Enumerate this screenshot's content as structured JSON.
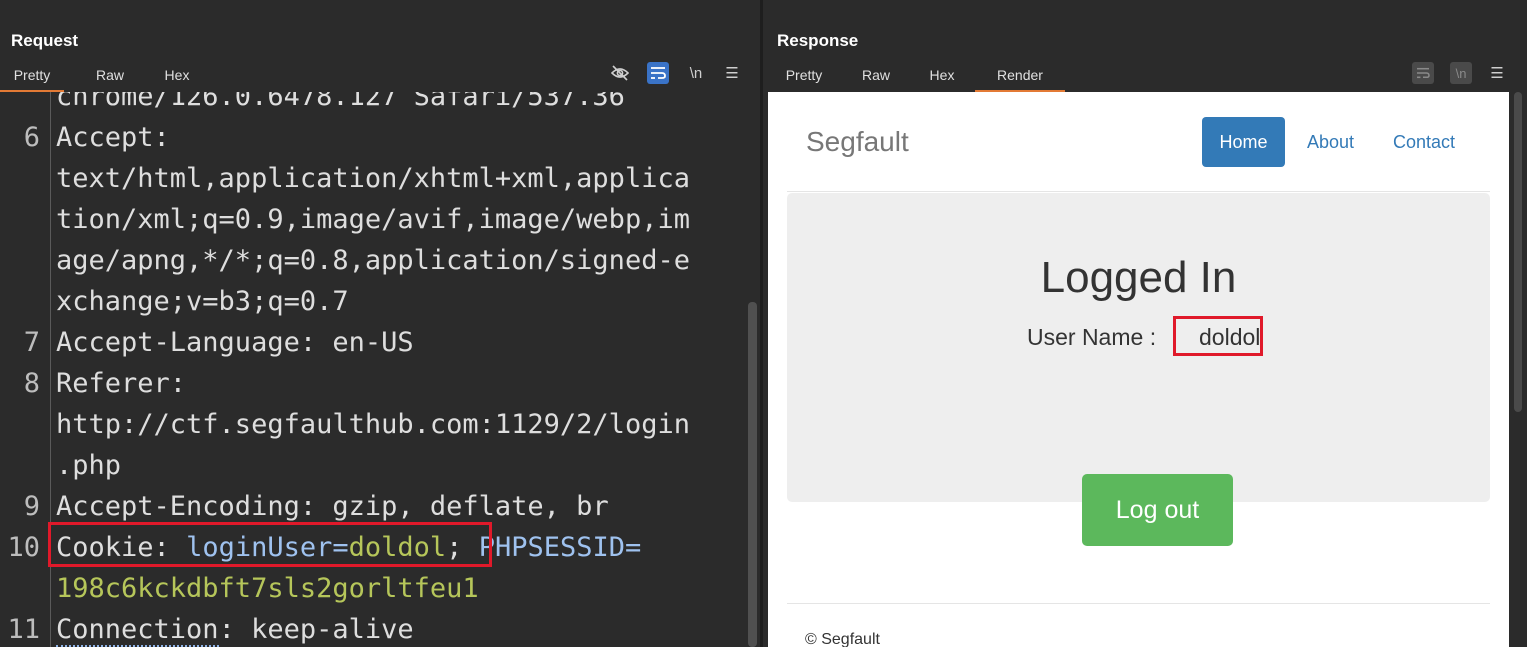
{
  "layout_buttons": [
    "side-by-side",
    "stacked-horizontal",
    "single"
  ],
  "request": {
    "title": "Request",
    "tabs": [
      "Pretty",
      "Raw",
      "Hex"
    ],
    "active_tab": "Pretty",
    "tools": {
      "hide_icon": "eye-off-icon",
      "wrap_icon": "word-wrap-icon",
      "newline_label": "\\n",
      "menu_icon": "hamburger-icon"
    },
    "lines": [
      {
        "num": "",
        "parts": [
          {
            "t": "chrome/126.0.6478.127 Safari/537.36",
            "c": "plain"
          }
        ]
      },
      {
        "num": "6",
        "parts": [
          {
            "t": "Accept:",
            "c": "plain"
          }
        ]
      },
      {
        "num": "",
        "parts": [
          {
            "t": "text/html,application/xhtml+xml,applica",
            "c": "plain"
          }
        ]
      },
      {
        "num": "",
        "parts": [
          {
            "t": "tion/xml;q=0.9,image/avif,image/webp,im",
            "c": "plain"
          }
        ]
      },
      {
        "num": "",
        "parts": [
          {
            "t": "age/apng,*/*;q=0.8,application/signed-e",
            "c": "plain"
          }
        ]
      },
      {
        "num": "",
        "parts": [
          {
            "t": "xchange;v=b3;q=0.7",
            "c": "plain"
          }
        ]
      },
      {
        "num": "7",
        "parts": [
          {
            "t": "Accept-Language",
            "c": "plain"
          },
          {
            "t": ": en-US",
            "c": "plain"
          }
        ]
      },
      {
        "num": "8",
        "parts": [
          {
            "t": "Referer:",
            "c": "plain"
          }
        ]
      },
      {
        "num": "",
        "parts": [
          {
            "t": "http://ctf.segfaulthub.com:1129/2/login",
            "c": "plain"
          }
        ]
      },
      {
        "num": "",
        "parts": [
          {
            "t": ".php",
            "c": "plain"
          }
        ]
      },
      {
        "num": "9",
        "parts": [
          {
            "t": "Accept-Encoding",
            "c": "plain"
          },
          {
            "t": ": gzip, deflate, br",
            "c": "plain"
          }
        ]
      },
      {
        "num": "10",
        "parts": [
          {
            "t": "Cookie",
            "c": "plain"
          },
          {
            "t": ": ",
            "c": "plain"
          },
          {
            "t": "loginUser=",
            "c": "blue"
          },
          {
            "t": "doldol",
            "c": "olive"
          },
          {
            "t": "; ",
            "c": "plain"
          },
          {
            "t": "PHPSESSID=",
            "c": "blue"
          }
        ]
      },
      {
        "num": "",
        "parts": [
          {
            "t": "198c6kckdbft7sls2gorltfeu1",
            "c": "olive"
          }
        ]
      },
      {
        "num": "11",
        "parts": [
          {
            "t": "Connection",
            "c": "plain"
          },
          {
            "t": ": keep-alive",
            "c": "plain"
          }
        ]
      }
    ]
  },
  "response": {
    "title": "Response",
    "tabs": [
      "Pretty",
      "Raw",
      "Hex",
      "Render"
    ],
    "active_tab": "Render",
    "tools": {
      "wrap_icon": "word-wrap-icon",
      "newline_label": "\\n",
      "menu_icon": "hamburger-icon"
    },
    "page": {
      "brand": "Segfault",
      "nav": [
        "Home",
        "About",
        "Contact"
      ],
      "heading": "Logged In",
      "user_label": "User Name :",
      "user_value": "doldol",
      "logout_label": "Log out",
      "footer": "© Segfault"
    }
  },
  "colors": {
    "highlight": "#e0192a",
    "active_tab_underline": "#e37a35",
    "primary": "#337ab7",
    "success": "#5cb85c",
    "key_blue": "#9fc2ef",
    "value_olive": "#b6c65a"
  }
}
